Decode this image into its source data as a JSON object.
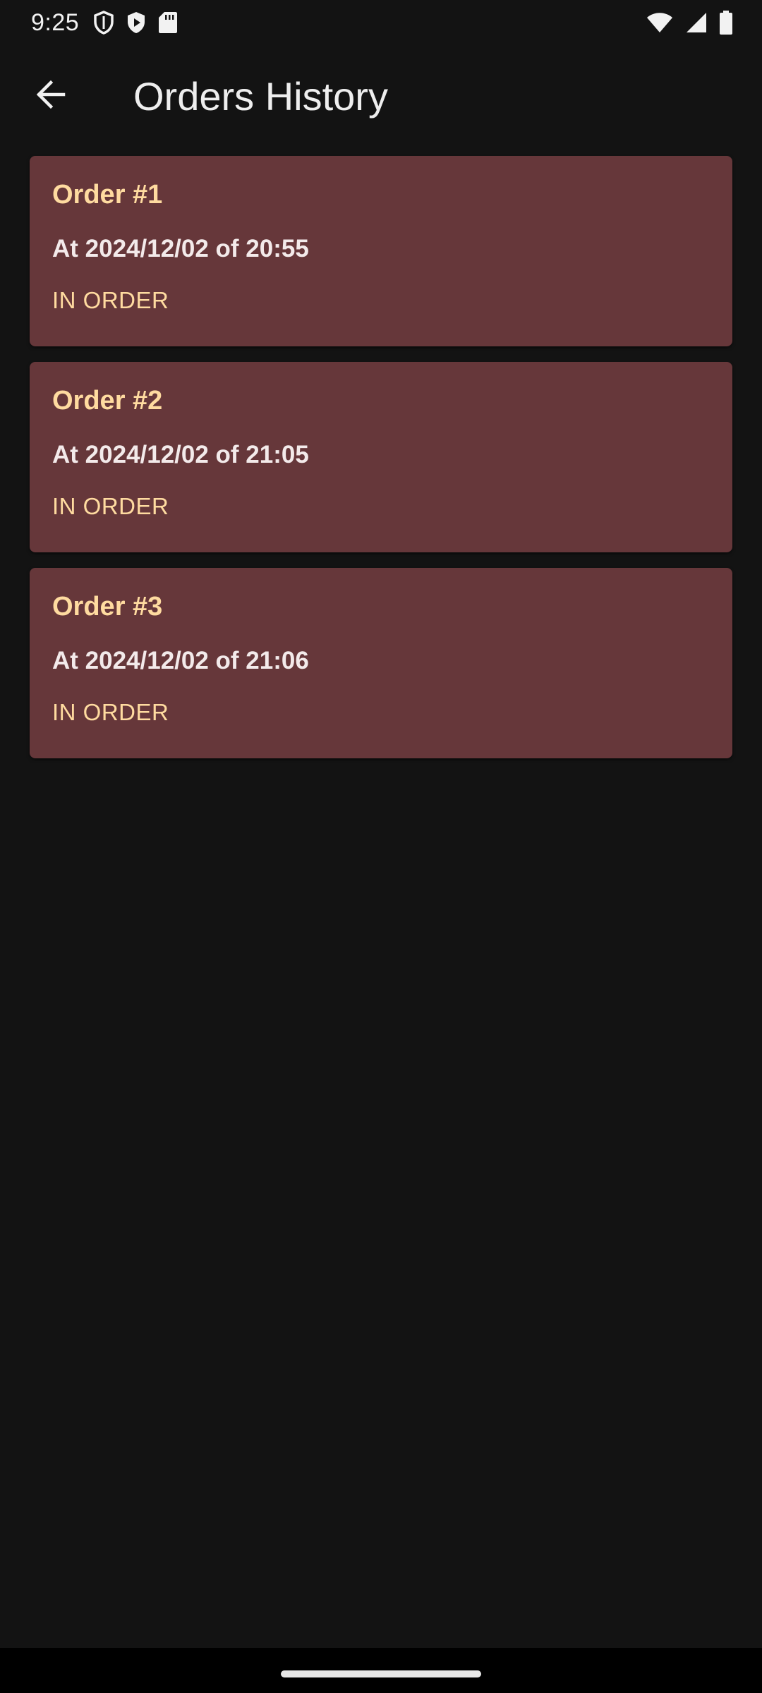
{
  "status_bar": {
    "time": "9:25",
    "left_icons": [
      "shield-outline-icon",
      "shield-play-icon",
      "sd-card-icon"
    ],
    "right_icons": [
      "wifi-icon",
      "cellular-signal-icon",
      "battery-icon"
    ]
  },
  "app_bar": {
    "title": "Orders History",
    "back_icon": "arrow-back-icon"
  },
  "orders": [
    {
      "title": "Order #1",
      "date": "At 2024/12/02 of 20:55",
      "status": "IN ORDER"
    },
    {
      "title": "Order #2",
      "date": "At 2024/12/02 of 21:05",
      "status": "IN ORDER"
    },
    {
      "title": "Order #3",
      "date": "At 2024/12/02 of 21:06",
      "status": "IN ORDER"
    }
  ],
  "colors": {
    "background": "#131313",
    "card": "#66373a",
    "accent": "#ffdba0",
    "text": "#f3eaea"
  }
}
